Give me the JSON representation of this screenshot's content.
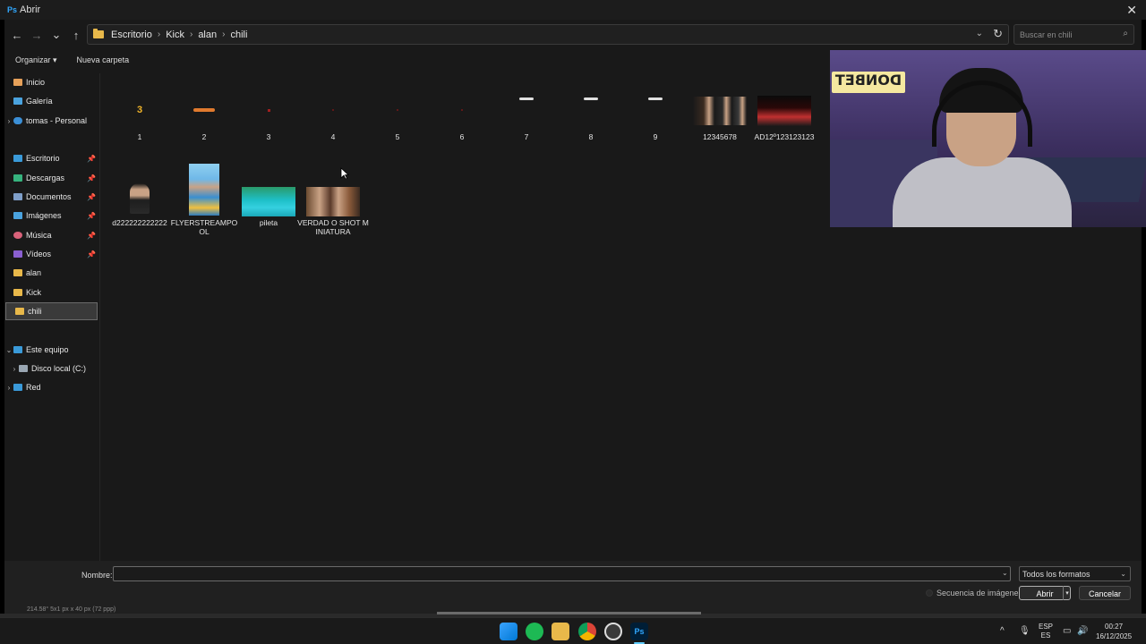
{
  "window": {
    "app_badge": "Ps",
    "title": "Abrir",
    "close": "✕"
  },
  "nav": {
    "back": "←",
    "forward": "→",
    "recent": "⌄",
    "up": "↑"
  },
  "breadcrumb": [
    "Escritorio",
    "Kick",
    "alan",
    "chili"
  ],
  "breadcrumb_sep": "›",
  "address": {
    "dropdown": "⌄",
    "refresh": "↻"
  },
  "search": {
    "placeholder": "Buscar en chili",
    "icon": "⌕"
  },
  "commands": {
    "organize": "Organizar ▾",
    "new_folder": "Nueva carpeta"
  },
  "sidebar": {
    "quick": [
      {
        "label": "Inicio",
        "icon": "home-icon",
        "color": "#e6a15a"
      },
      {
        "label": "Galería",
        "icon": "gallery-icon",
        "color": "#4aa3df"
      },
      {
        "label": "tomas - Personal",
        "icon": "cloud-icon",
        "color": "#3b8fd6",
        "chevron": "›"
      }
    ],
    "pinned": [
      {
        "label": "Escritorio",
        "icon": "desktop-icon",
        "color": "#3a9ad9"
      },
      {
        "label": "Descargas",
        "icon": "download-icon",
        "color": "#36b37e"
      },
      {
        "label": "Documentos",
        "icon": "documents-icon",
        "color": "#7f9fc9"
      },
      {
        "label": "Imágenes",
        "icon": "pictures-icon",
        "color": "#4aa3df"
      },
      {
        "label": "Música",
        "icon": "music-icon",
        "color": "#d9627a"
      },
      {
        "label": "Vídeos",
        "icon": "videos-icon",
        "color": "#8a5fd0"
      }
    ],
    "folders": [
      {
        "label": "alan",
        "icon": "folder-icon",
        "color": "#e8b84a"
      },
      {
        "label": "Kick",
        "icon": "folder-icon",
        "color": "#e8b84a"
      },
      {
        "label": "chili",
        "icon": "folder-icon",
        "color": "#e8b84a"
      }
    ],
    "pin_glyph": "📌",
    "tree": [
      {
        "label": "Este equipo",
        "icon": "this-pc-icon",
        "color": "#3a9ad9",
        "chevron": "⌄"
      },
      {
        "label": "Disco local (C:)",
        "icon": "drive-icon",
        "color": "#9aa7b3",
        "chevron": "›"
      },
      {
        "label": "Red",
        "icon": "network-icon",
        "color": "#3a9ad9",
        "chevron": "›"
      }
    ]
  },
  "files": [
    {
      "name": "1"
    },
    {
      "name": "2"
    },
    {
      "name": "3"
    },
    {
      "name": "4"
    },
    {
      "name": "5"
    },
    {
      "name": "6"
    },
    {
      "name": "7"
    },
    {
      "name": "8"
    },
    {
      "name": "9"
    },
    {
      "name": "12345678"
    },
    {
      "name": "AD12º123123123"
    },
    {
      "name": "d222222222222"
    },
    {
      "name": "FLYERSTREAMPOOL"
    },
    {
      "name": "pileta"
    },
    {
      "name": "VERDAD O SHOT MINIATURA"
    }
  ],
  "thumb_glyph_1": "3",
  "webcam": {
    "sign": "DONBET"
  },
  "bottom": {
    "name_label": "Nombre:",
    "name_value": "",
    "filter": "Todos los formatos",
    "sequence": "Secuencia de imágenes",
    "open": "Abrir",
    "cancel": "Cancelar",
    "chevron": "⌄",
    "split": "▾"
  },
  "ps_status": "214.58°          5x1 px x 40 px (72 ppp)",
  "taskbar": {
    "ps_label": "Ps",
    "chevron_up": "^",
    "lang": "ESP",
    "lang_sub": "ES",
    "mic": "🎙",
    "display": "▭",
    "volume": "🔊",
    "time": "00:27",
    "date": "16/12/2025"
  }
}
